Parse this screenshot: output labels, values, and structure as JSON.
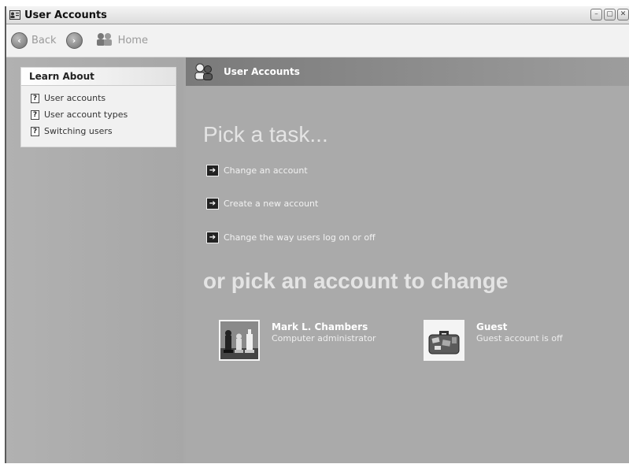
{
  "window": {
    "title": "User Accounts",
    "controls": {
      "minimize": "–",
      "maximize": "▢",
      "close": "✕"
    }
  },
  "toolbar": {
    "back_label": "Back",
    "forward_symbol": "›",
    "back_symbol": "‹",
    "home_label": "Home"
  },
  "sidebar": {
    "learn_about": {
      "title": "Learn About",
      "items": [
        {
          "label": "User accounts",
          "icon": "help-icon"
        },
        {
          "label": "User account types",
          "icon": "help-icon"
        },
        {
          "label": "Switching users",
          "icon": "help-icon"
        }
      ]
    }
  },
  "content": {
    "header_title": "User Accounts",
    "pick_task_heading": "Pick a task...",
    "tasks": [
      {
        "label": "Change an account",
        "icon": "arrow-right-icon"
      },
      {
        "label": "Create a new account",
        "icon": "arrow-right-icon"
      },
      {
        "label": "Change the way users log on or off",
        "icon": "arrow-right-icon"
      }
    ],
    "pick_account_heading": "or pick an account to change",
    "accounts": [
      {
        "name": "Mark L. Chambers",
        "description": "Computer administrator",
        "picture": "chess-pieces-icon"
      },
      {
        "name": "Guest",
        "description": "Guest account is off",
        "picture": "suitcase-icon"
      }
    ]
  },
  "colors": {
    "window_bg": "#a9a9a9",
    "toolbar_bg": "#f2f2f2",
    "header_text": "#ffffff",
    "heading_text": "#e4e4e4"
  }
}
